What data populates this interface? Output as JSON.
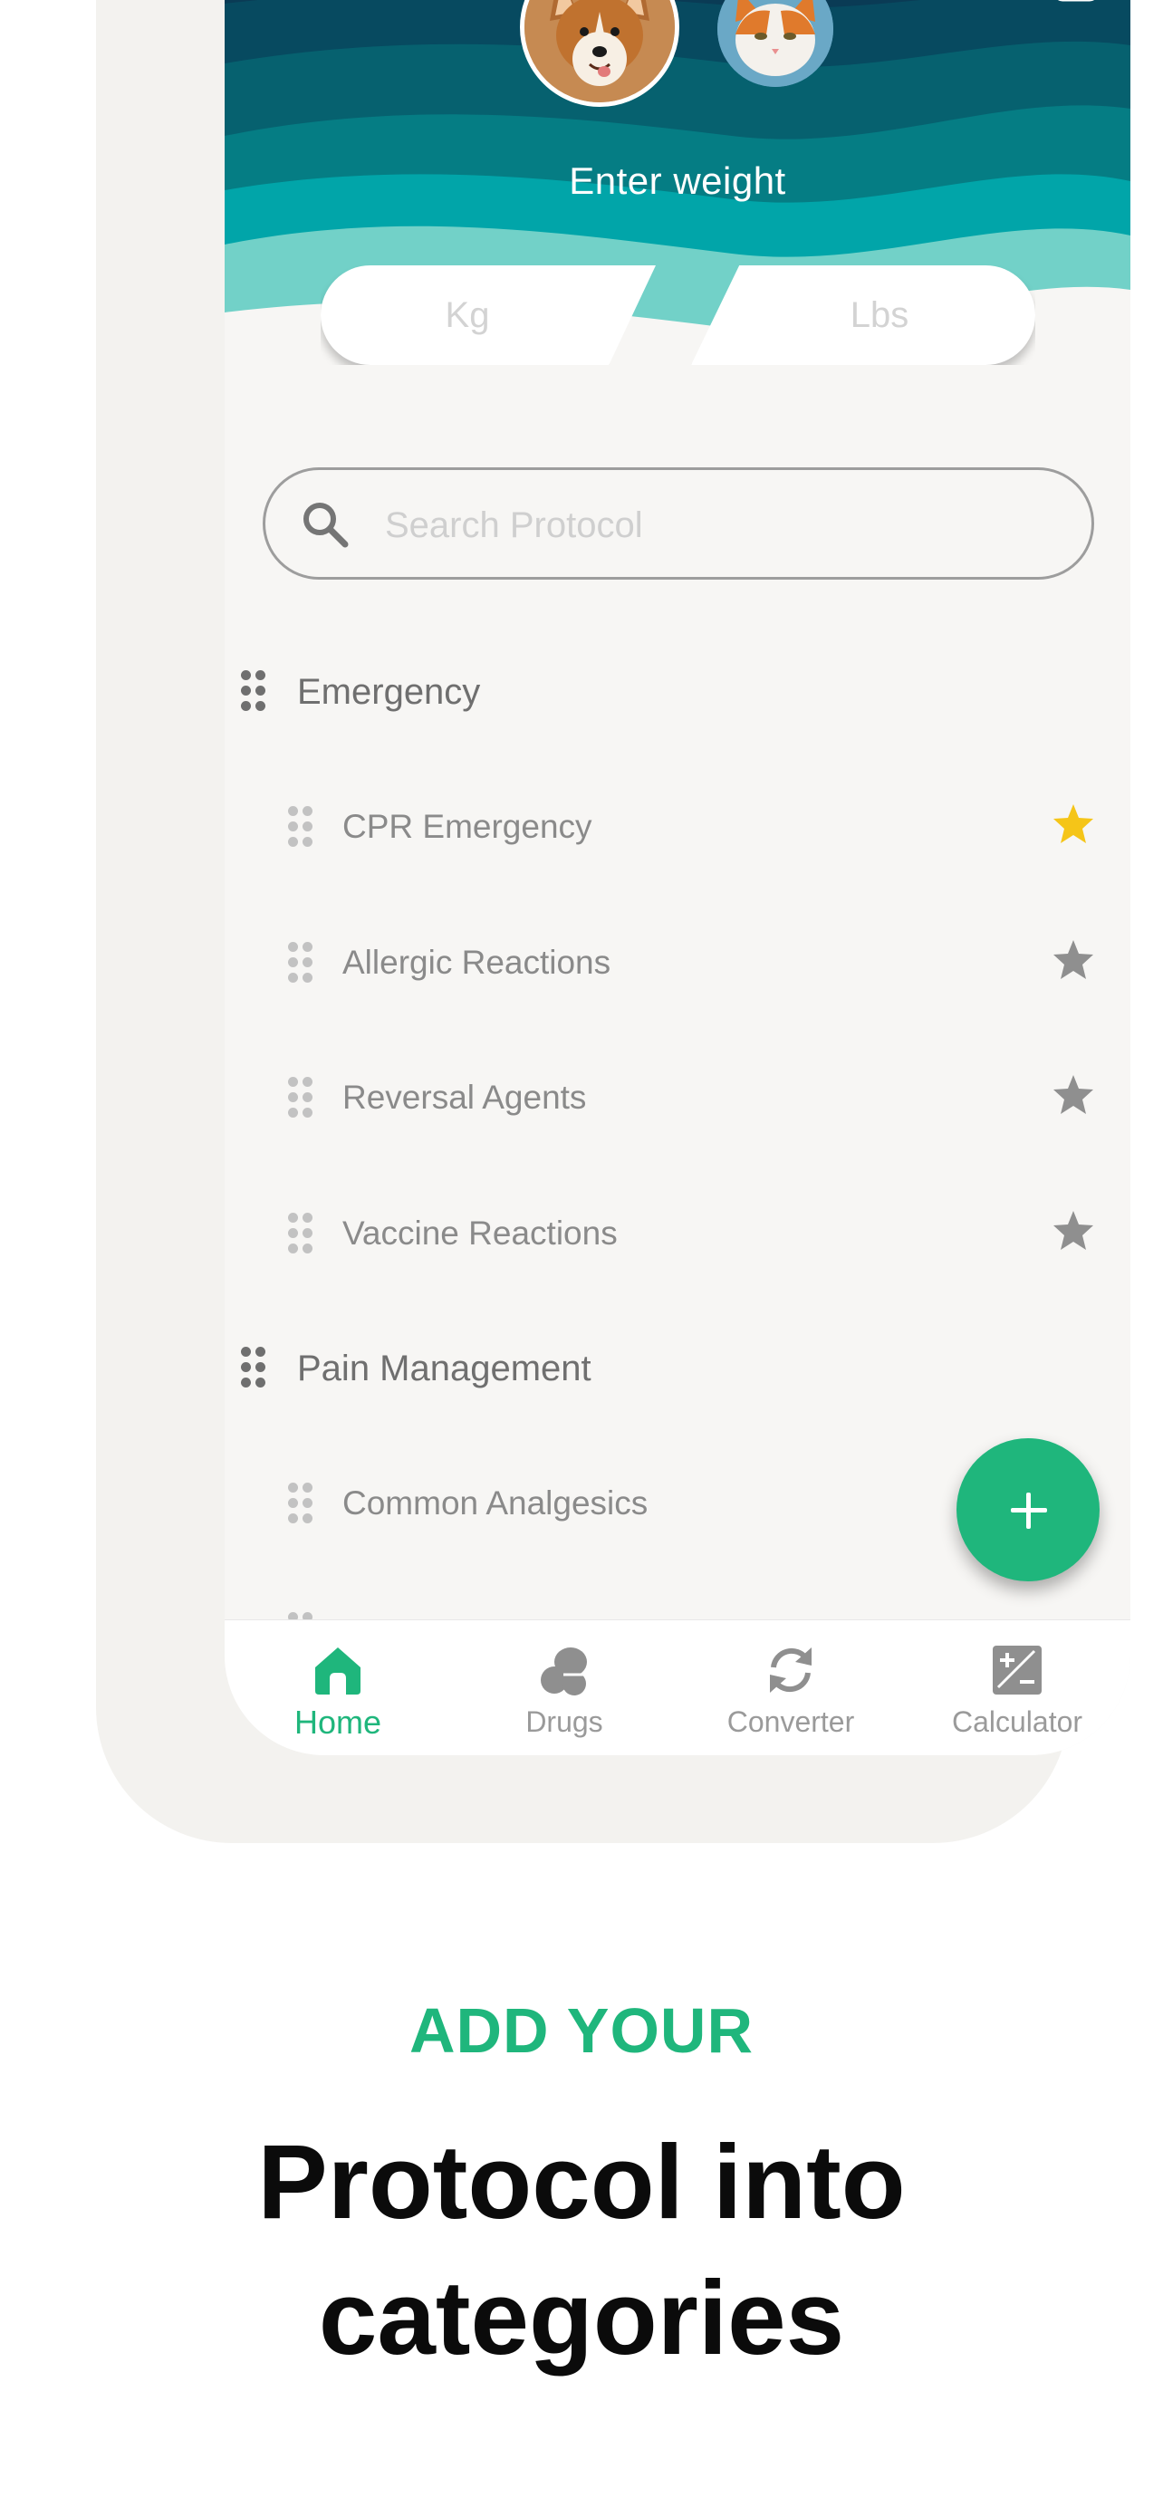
{
  "header": {
    "weight_title": "Enter weight",
    "unit_kg_placeholder": "Kg",
    "unit_lbs_placeholder": "Lbs",
    "wave_colors": [
      "#0a3b55",
      "#074a60",
      "#06616f",
      "#057d84",
      "#01a5a9",
      "#72d1c8"
    ]
  },
  "search": {
    "placeholder": "Search Protocol"
  },
  "categories": [
    {
      "title": "Emergency",
      "items": [
        {
          "title": "CPR Emergency",
          "favorite": true
        },
        {
          "title": "Allergic Reactions",
          "favorite": false
        },
        {
          "title": "Reversal Agents",
          "favorite": false
        },
        {
          "title": "Vaccine Reactions",
          "favorite": false
        }
      ]
    },
    {
      "title": "Pain Management",
      "items": [
        {
          "title": "Common Analgesics",
          "favorite": false
        }
      ]
    }
  ],
  "colors": {
    "accent": "#1fb67c",
    "star_active": "#f5c518",
    "star_inactive": "#8f8f8f"
  },
  "bottom_nav": [
    {
      "label": "Home",
      "icon": "home-icon",
      "active": true
    },
    {
      "label": "Drugs",
      "icon": "pills-icon",
      "active": false
    },
    {
      "label": "Converter",
      "icon": "refresh-icon",
      "active": false
    },
    {
      "label": "Calculator",
      "icon": "calculator-icon",
      "active": false
    }
  ],
  "marketing": {
    "eyebrow": "ADD YOUR",
    "headline_line1": "Protocol into",
    "headline_line2": "categories"
  }
}
